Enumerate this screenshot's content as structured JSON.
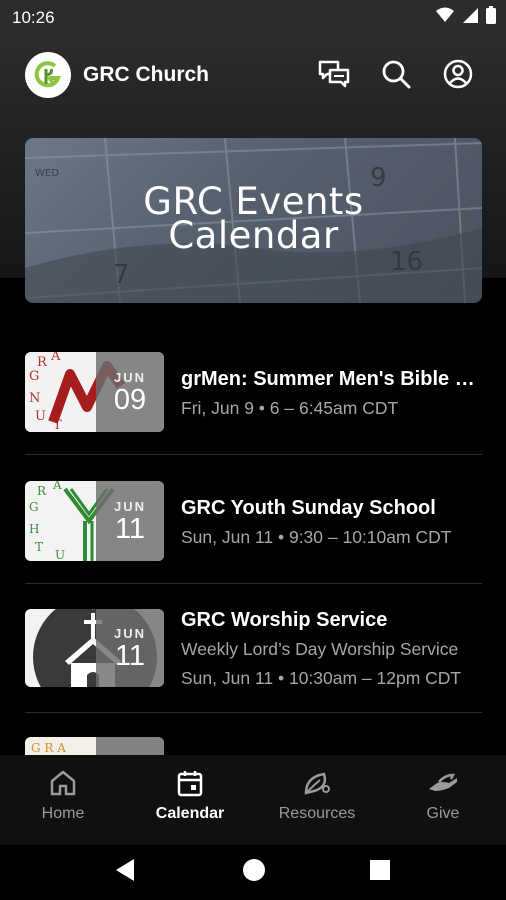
{
  "status_bar": {
    "time": "10:26"
  },
  "app_bar": {
    "title": "GRC Church",
    "actions": [
      "messages-icon",
      "search-icon",
      "account-icon"
    ]
  },
  "banner": {
    "line1": "GRC Events",
    "line2": "Calendar"
  },
  "events": [
    {
      "title": "grMen: Summer Men's Bible Study",
      "month": "JUN",
      "day": "09",
      "line1": "Fri, Jun 9 • 6 – 6:45am CDT",
      "line2": ""
    },
    {
      "title": "GRC Youth Sunday School",
      "month": "JUN",
      "day": "11",
      "line1": "Sun, Jun 11 • 9:30 – 10:10am CDT",
      "line2": ""
    },
    {
      "title": "GRC Worship Service",
      "month": "JUN",
      "day": "11",
      "line1": "Weekly Lord’s Day Worship Service",
      "line2": "Sun, Jun 11 • 10:30am – 12pm CDT"
    }
  ],
  "bottom_nav": [
    {
      "label": "Home",
      "icon": "home-icon",
      "active": false
    },
    {
      "label": "Calendar",
      "icon": "calendar-icon",
      "active": true
    },
    {
      "label": "Resources",
      "icon": "leaf-icon",
      "active": false
    },
    {
      "label": "Give",
      "icon": "give-hand-icon",
      "active": false
    }
  ],
  "colors": {
    "background": "#000000",
    "header": "#2a2c2e",
    "muted_text": "#a6a6a6",
    "accent_green": "#8cc63f"
  }
}
